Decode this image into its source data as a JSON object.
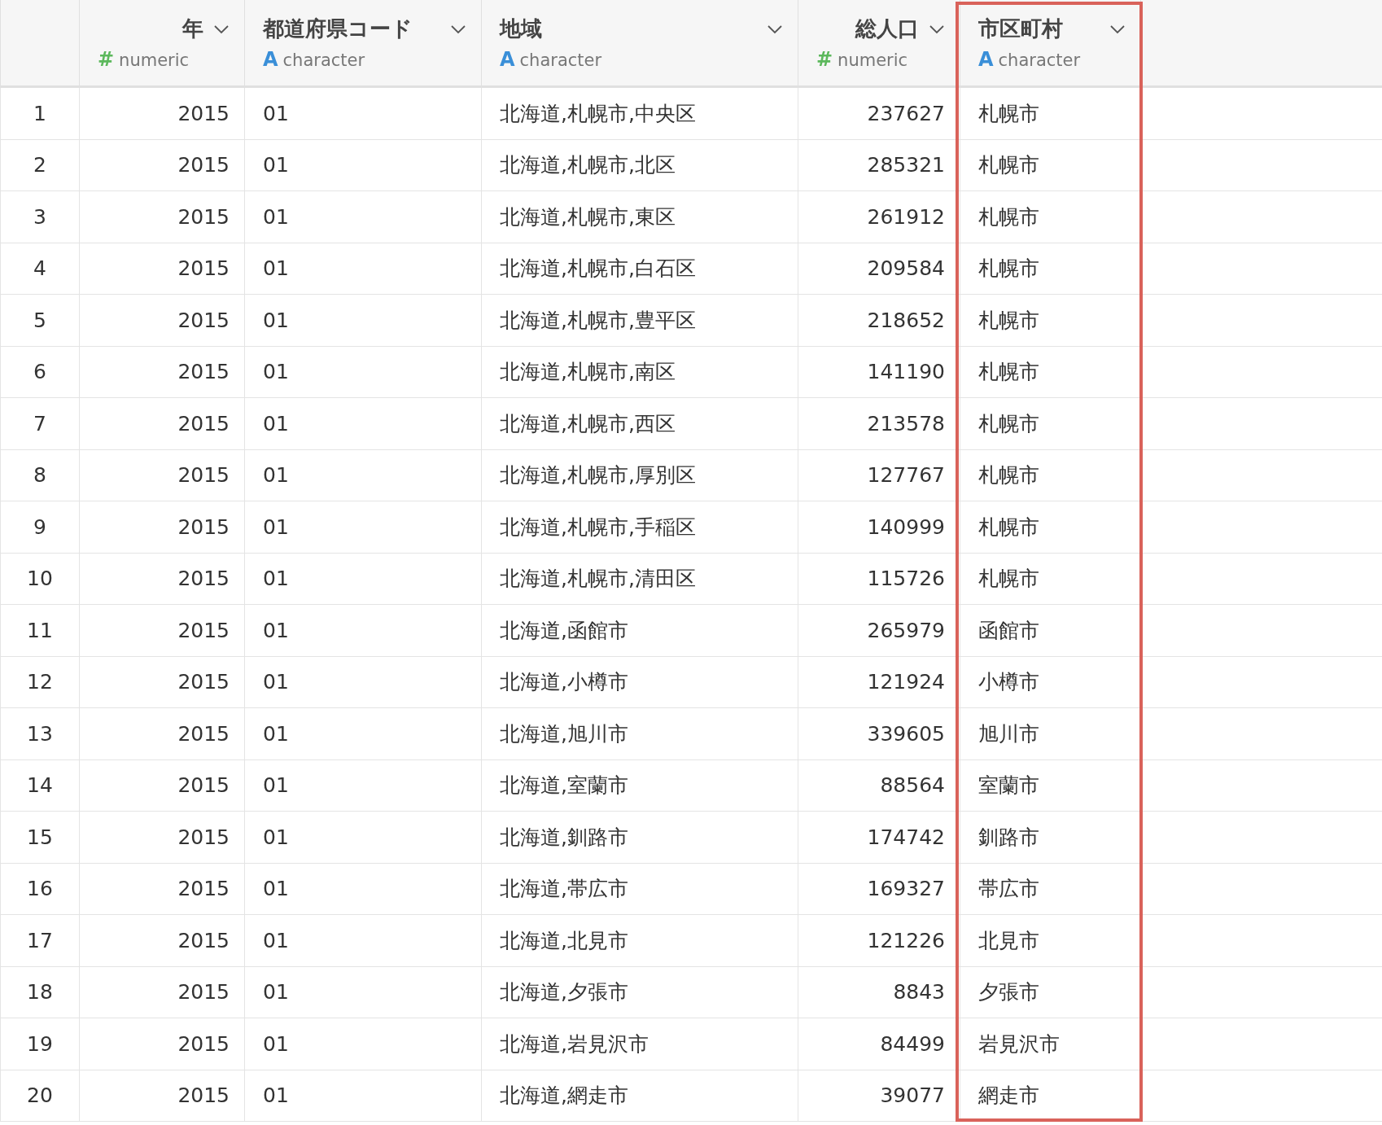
{
  "table": {
    "columns": [
      {
        "name": "年",
        "type_icon": "#",
        "type": "numeric",
        "kind": "numeric",
        "highlighted": false
      },
      {
        "name": "都道府県コード",
        "type_icon": "A",
        "type": "character",
        "kind": "character",
        "highlighted": false
      },
      {
        "name": "地域",
        "type_icon": "A",
        "type": "character",
        "kind": "character",
        "highlighted": false
      },
      {
        "name": "総人口",
        "type_icon": "#",
        "type": "numeric",
        "kind": "numeric",
        "highlighted": false
      },
      {
        "name": "市区町村",
        "type_icon": "A",
        "type": "character",
        "kind": "character",
        "highlighted": true
      }
    ],
    "rows": [
      {
        "index": "1",
        "cells": [
          "2015",
          "01",
          "北海道,札幌市,中央区",
          "237627",
          "札幌市"
        ]
      },
      {
        "index": "2",
        "cells": [
          "2015",
          "01",
          "北海道,札幌市,北区",
          "285321",
          "札幌市"
        ]
      },
      {
        "index": "3",
        "cells": [
          "2015",
          "01",
          "北海道,札幌市,東区",
          "261912",
          "札幌市"
        ]
      },
      {
        "index": "4",
        "cells": [
          "2015",
          "01",
          "北海道,札幌市,白石区",
          "209584",
          "札幌市"
        ]
      },
      {
        "index": "5",
        "cells": [
          "2015",
          "01",
          "北海道,札幌市,豊平区",
          "218652",
          "札幌市"
        ]
      },
      {
        "index": "6",
        "cells": [
          "2015",
          "01",
          "北海道,札幌市,南区",
          "141190",
          "札幌市"
        ]
      },
      {
        "index": "7",
        "cells": [
          "2015",
          "01",
          "北海道,札幌市,西区",
          "213578",
          "札幌市"
        ]
      },
      {
        "index": "8",
        "cells": [
          "2015",
          "01",
          "北海道,札幌市,厚別区",
          "127767",
          "札幌市"
        ]
      },
      {
        "index": "9",
        "cells": [
          "2015",
          "01",
          "北海道,札幌市,手稲区",
          "140999",
          "札幌市"
        ]
      },
      {
        "index": "10",
        "cells": [
          "2015",
          "01",
          "北海道,札幌市,清田区",
          "115726",
          "札幌市"
        ]
      },
      {
        "index": "11",
        "cells": [
          "2015",
          "01",
          "北海道,函館市",
          "265979",
          "函館市"
        ]
      },
      {
        "index": "12",
        "cells": [
          "2015",
          "01",
          "北海道,小樽市",
          "121924",
          "小樽市"
        ]
      },
      {
        "index": "13",
        "cells": [
          "2015",
          "01",
          "北海道,旭川市",
          "339605",
          "旭川市"
        ]
      },
      {
        "index": "14",
        "cells": [
          "2015",
          "01",
          "北海道,室蘭市",
          "88564",
          "室蘭市"
        ]
      },
      {
        "index": "15",
        "cells": [
          "2015",
          "01",
          "北海道,釧路市",
          "174742",
          "釧路市"
        ]
      },
      {
        "index": "16",
        "cells": [
          "2015",
          "01",
          "北海道,帯広市",
          "169327",
          "帯広市"
        ]
      },
      {
        "index": "17",
        "cells": [
          "2015",
          "01",
          "北海道,北見市",
          "121226",
          "北見市"
        ]
      },
      {
        "index": "18",
        "cells": [
          "2015",
          "01",
          "北海道,夕張市",
          "8843",
          "夕張市"
        ]
      },
      {
        "index": "19",
        "cells": [
          "2015",
          "01",
          "北海道,岩見沢市",
          "84499",
          "岩見沢市"
        ]
      },
      {
        "index": "20",
        "cells": [
          "2015",
          "01",
          "北海道,網走市",
          "39077",
          "網走市"
        ]
      }
    ]
  }
}
